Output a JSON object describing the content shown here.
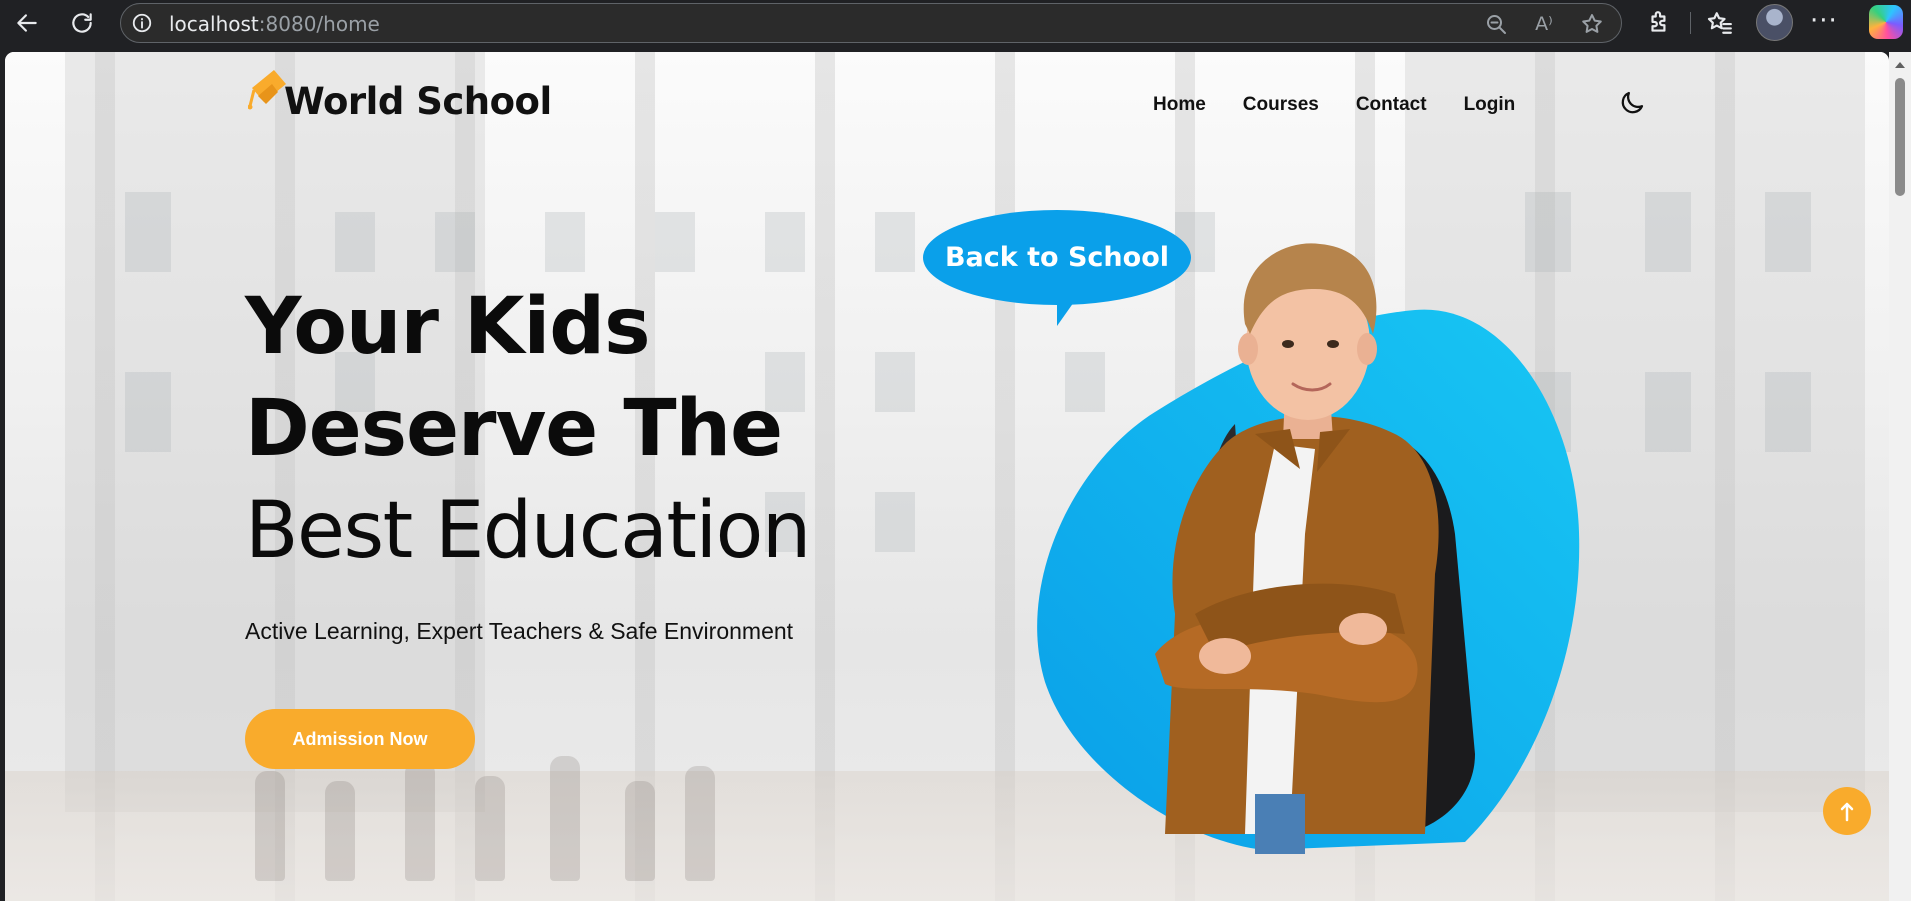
{
  "browser": {
    "url_host": "localhost",
    "url_path": ":8080/home",
    "reader_label": "A⁾",
    "menu_dots": "···"
  },
  "site": {
    "brand": "World School",
    "nav": [
      "Home",
      "Courses",
      "Contact",
      "Login"
    ]
  },
  "hero": {
    "line1": "Your Kids",
    "line2": "Deserve The",
    "line3": "Best Education",
    "tagline": "Active Learning, Expert Teachers & Safe Environment",
    "cta_label": "Admission Now",
    "bubble_text": "Back to School"
  },
  "colors": {
    "accent": "#f9ab2c",
    "blue": "#0aa0ea",
    "blob_from": "#0a9fe8",
    "blob_to": "#18c6f4"
  },
  "icons": {
    "back": "back-arrow-icon",
    "refresh": "refresh-icon",
    "info": "info-icon",
    "zoom": "zoom-out-icon",
    "favorite": "star-icon",
    "extensions": "puzzle-icon",
    "favorites": "favorites-icon",
    "theme": "moon-icon",
    "scroll_top": "arrow-up-icon"
  }
}
